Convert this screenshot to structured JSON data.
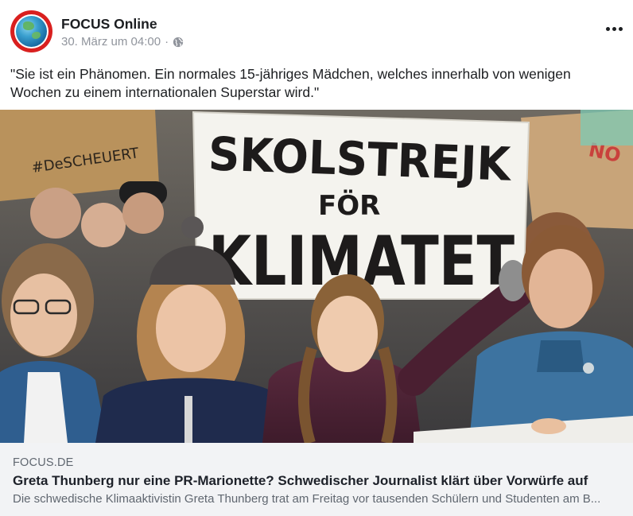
{
  "header": {
    "page_name": "FOCUS Online",
    "timestamp": "30. März um 04:00",
    "separator": "·",
    "avatar_icon": "focus-globe-logo",
    "privacy_icon": "globe-icon",
    "more_icon": "ellipsis-icon"
  },
  "post": {
    "text": "\"Sie ist ein Phänomen. Ein normales 15-jähriges Mädchen, welches innerhalb von wenigen Wochen zu einem internationalen Superstar wird.\""
  },
  "photo": {
    "sign_line1": "SKOLSTREJK",
    "sign_line2": "FÖR",
    "sign_line3": "KLIMATET",
    "side_sign_text": "#DeSCHEUERT",
    "right_sign_text": "NO"
  },
  "link": {
    "domain": "FOCUS.DE",
    "title": "Greta Thunberg nur eine PR-Marionette? Schwedischer Journalist klärt über Vorwürfe auf",
    "description": "Die schwedische Klimaaktivistin Greta Thunberg trat am Freitag vor tausenden Schülern und Studenten am B..."
  },
  "colors": {
    "brand_red": "#d9201f",
    "text_primary": "#1c1e21",
    "text_secondary": "#90949c",
    "link_bg": "#f2f3f5"
  }
}
